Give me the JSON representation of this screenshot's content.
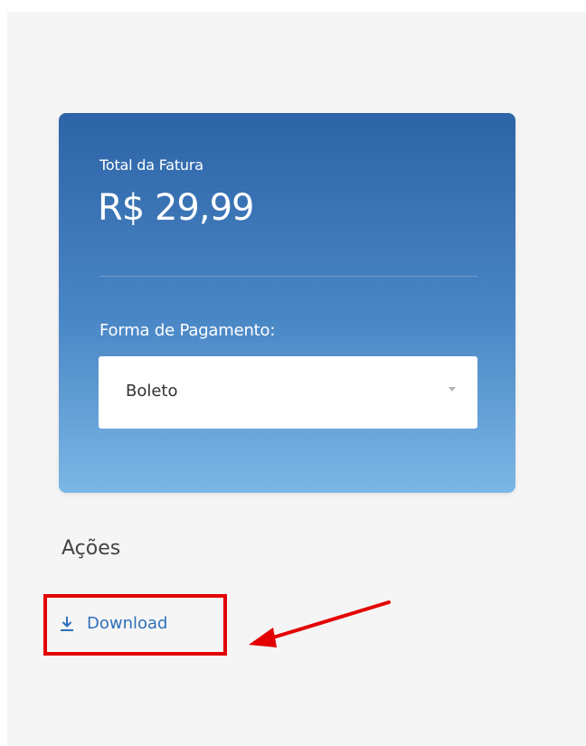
{
  "invoice": {
    "total_label": "Total da Fatura",
    "total_value": "R$ 29,99",
    "payment_label": "Forma de Pagamento:",
    "payment_method": "Boleto"
  },
  "actions": {
    "title": "Ações",
    "download_label": "Download"
  },
  "colors": {
    "card_top": "#2d64a7",
    "card_bottom": "#7bb7e5",
    "link": "#2f6fb8",
    "annotation": "#e30000"
  },
  "icons": {
    "download": "download-icon",
    "select_caret": "chevron-down-icon",
    "annotation_arrow": "arrow-icon"
  }
}
